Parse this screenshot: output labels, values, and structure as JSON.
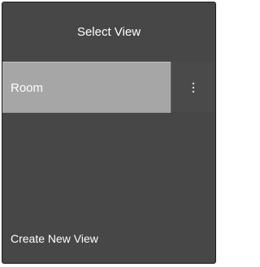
{
  "dialog": {
    "title": "Select View"
  },
  "views": [
    {
      "label": "Room",
      "selected": true
    }
  ],
  "menu_icon": "more-vertical-icon",
  "actions": {
    "create_label": "Create New View"
  },
  "colors": {
    "panel_bg": "#474747",
    "selected_bg": "#a6a6a6",
    "text": "#ffffff"
  }
}
